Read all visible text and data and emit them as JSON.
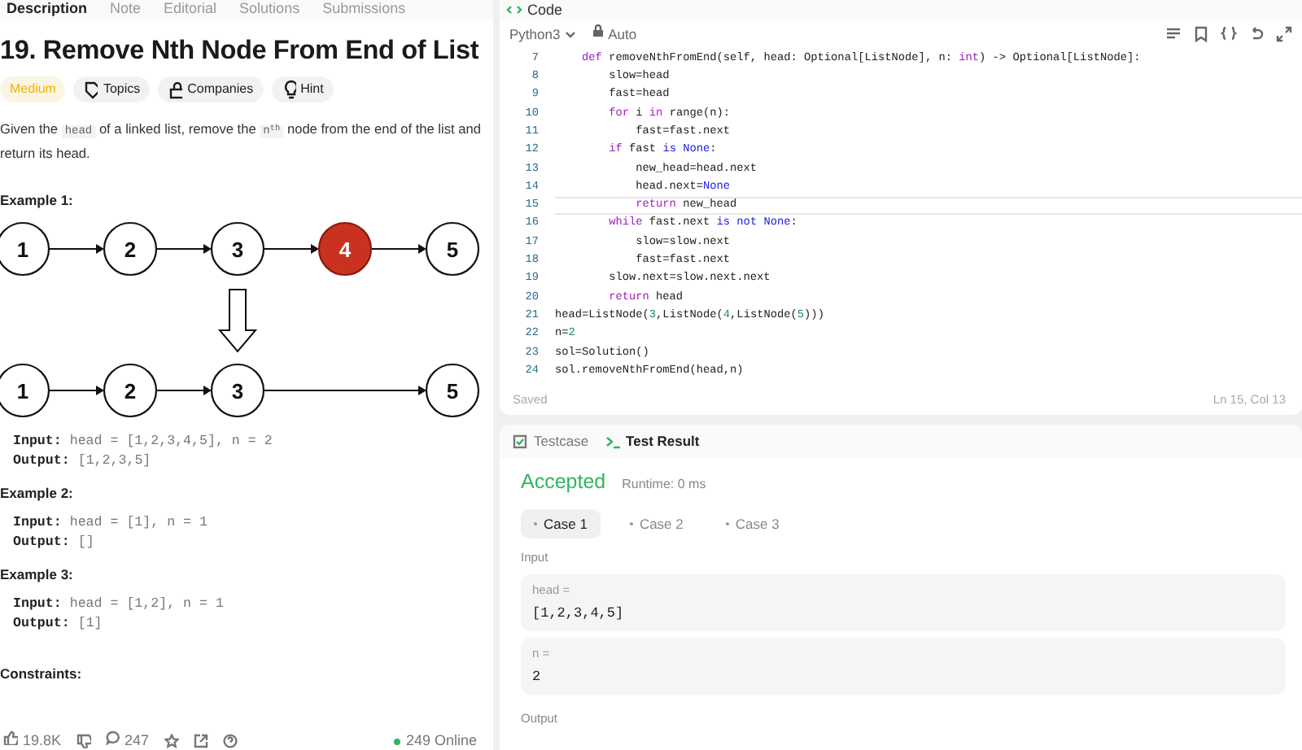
{
  "problem_tabs": [
    {
      "label": "Description",
      "selected": true
    },
    {
      "label": "Note",
      "selected": false
    },
    {
      "label": "Editorial",
      "selected": false
    },
    {
      "label": "Solutions",
      "selected": false
    },
    {
      "label": "Submissions",
      "selected": false
    }
  ],
  "title": "19. Remove Nth Node From End of List",
  "difficulty": "Medium",
  "tags": [
    "Topics",
    "Companies",
    "Hint"
  ],
  "description": [
    {
      "kind": "text",
      "text": "Given the "
    },
    {
      "kind": "code",
      "text": "head"
    },
    {
      "kind": "text",
      "text": " of a linked list, remove the "
    },
    {
      "kind": "code",
      "text": "n$^{th}$"
    },
    {
      "kind": "text",
      "text": " node from the end of the list and return its head."
    }
  ],
  "examples": [
    {
      "title": "Example 1:",
      "input_label": "Input:",
      "input": "head = [1,2,3,4,5], n = 2",
      "output_label": "Output:",
      "output": "[1,2,3,5]",
      "diagram": {
        "before": [
          {
            "label": "1",
            "removed": false
          },
          {
            "label": "2",
            "removed": false
          },
          {
            "label": "3",
            "removed": false
          },
          {
            "label": "4",
            "removed": true
          },
          {
            "label": "5",
            "removed": false
          }
        ],
        "after": [
          {
            "label": "1"
          },
          {
            "label": "2"
          },
          {
            "label": "3"
          },
          {
            "label": "5"
          }
        ]
      }
    },
    {
      "title": "Example 2:",
      "input_label": "Input:",
      "input": "head = [1], n = 1",
      "output_label": "Output:",
      "output": "[]"
    },
    {
      "title": "Example 3:",
      "input_label": "Input:",
      "input": "head = [1,2], n = 1",
      "output_label": "Output:",
      "output": "[1]"
    }
  ],
  "constraints_title": "Constraints:",
  "footer": {
    "likes": "19.8K",
    "comments": "247",
    "online": "249 Online"
  },
  "code_panel": {
    "title": "Code",
    "language": "Python3",
    "mode": "Auto",
    "lines": [
      {
        "no": "7",
        "current": false,
        "tokens": [
          {
            "kind": "keyword",
            "text": "    def "
          },
          {
            "kind": "plain",
            "text": "removeNthFromEnd(self, head: Optional[ListNode], n: "
          },
          {
            "kind": "keyword",
            "text": "int"
          },
          {
            "kind": "plain",
            "text": ") -> Optional[ListNode]:"
          }
        ]
      },
      {
        "no": "8",
        "current": false,
        "tokens": [
          {
            "kind": "plain",
            "text": "        slow=head"
          }
        ]
      },
      {
        "no": "9",
        "current": false,
        "tokens": [
          {
            "kind": "plain",
            "text": "        fast=head"
          }
        ]
      },
      {
        "no": "10",
        "current": false,
        "tokens": [
          {
            "kind": "keyword",
            "text": "        for "
          },
          {
            "kind": "plain",
            "text": "i "
          },
          {
            "kind": "keyword",
            "text": "in "
          },
          {
            "kind": "plain",
            "text": "range(n):"
          }
        ]
      },
      {
        "no": "11",
        "current": false,
        "tokens": [
          {
            "kind": "plain",
            "text": "            fast=fast.next"
          }
        ]
      },
      {
        "no": "12",
        "current": false,
        "tokens": [
          {
            "kind": "keyword",
            "text": "        if "
          },
          {
            "kind": "plain",
            "text": "fast "
          },
          {
            "kind": "constant",
            "text": "is None"
          },
          {
            "kind": "plain",
            "text": ":"
          }
        ]
      },
      {
        "no": "13",
        "current": false,
        "tokens": [
          {
            "kind": "plain",
            "text": "            new_head=head.next"
          }
        ]
      },
      {
        "no": "14",
        "current": false,
        "tokens": [
          {
            "kind": "plain",
            "text": "            head.next="
          },
          {
            "kind": "constant",
            "text": "None"
          }
        ]
      },
      {
        "no": "15",
        "current": true,
        "tokens": [
          {
            "kind": "keyword",
            "text": "            return "
          },
          {
            "kind": "plain",
            "text": "new_head"
          }
        ]
      },
      {
        "no": "16",
        "current": false,
        "tokens": [
          {
            "kind": "keyword",
            "text": "        while "
          },
          {
            "kind": "plain",
            "text": "fast.next "
          },
          {
            "kind": "constant",
            "text": "is not None"
          },
          {
            "kind": "plain",
            "text": ":"
          }
        ]
      },
      {
        "no": "17",
        "current": false,
        "tokens": [
          {
            "kind": "plain",
            "text": "            slow=slow.next"
          }
        ]
      },
      {
        "no": "18",
        "current": false,
        "tokens": [
          {
            "kind": "plain",
            "text": "            fast=fast.next"
          }
        ]
      },
      {
        "no": "19",
        "current": false,
        "tokens": [
          {
            "kind": "plain",
            "text": "        slow.next=slow.next.next"
          }
        ]
      },
      {
        "no": "20",
        "current": false,
        "tokens": [
          {
            "kind": "keyword",
            "text": "        return "
          },
          {
            "kind": "plain",
            "text": "head"
          }
        ]
      },
      {
        "no": "21",
        "current": false,
        "tokens": [
          {
            "kind": "plain",
            "text": "head=ListNode("
          },
          {
            "kind": "number",
            "text": "3"
          },
          {
            "kind": "plain",
            "text": ",ListNode("
          },
          {
            "kind": "number",
            "text": "4"
          },
          {
            "kind": "plain",
            "text": ",ListNode("
          },
          {
            "kind": "number",
            "text": "5"
          },
          {
            "kind": "plain",
            "text": ")))"
          }
        ]
      },
      {
        "no": "22",
        "current": false,
        "tokens": [
          {
            "kind": "plain",
            "text": "n="
          },
          {
            "kind": "number",
            "text": "2"
          }
        ]
      },
      {
        "no": "23",
        "current": false,
        "tokens": [
          {
            "kind": "plain",
            "text": "sol=Solution()"
          }
        ]
      },
      {
        "no": "24",
        "current": false,
        "tokens": [
          {
            "kind": "plain",
            "text": "sol.removeNthFromEnd(head,n)"
          }
        ]
      }
    ],
    "status": "Saved",
    "cursor": "Ln 15, Col 13"
  },
  "result_panel": {
    "tabs": [
      {
        "label": "Testcase",
        "selected": false
      },
      {
        "label": "Test Result",
        "selected": true
      }
    ],
    "verdict": "Accepted",
    "runtime": "Runtime: 0 ms",
    "cases": [
      {
        "label": "Case 1",
        "selected": true
      },
      {
        "label": "Case 2",
        "selected": false
      },
      {
        "label": "Case 3",
        "selected": false
      }
    ],
    "input_label": "Input",
    "inputs": [
      {
        "name": "head =",
        "value": "[1,2,3,4,5]"
      },
      {
        "name": "n =",
        "value": "2"
      }
    ],
    "output_label": "Output"
  }
}
